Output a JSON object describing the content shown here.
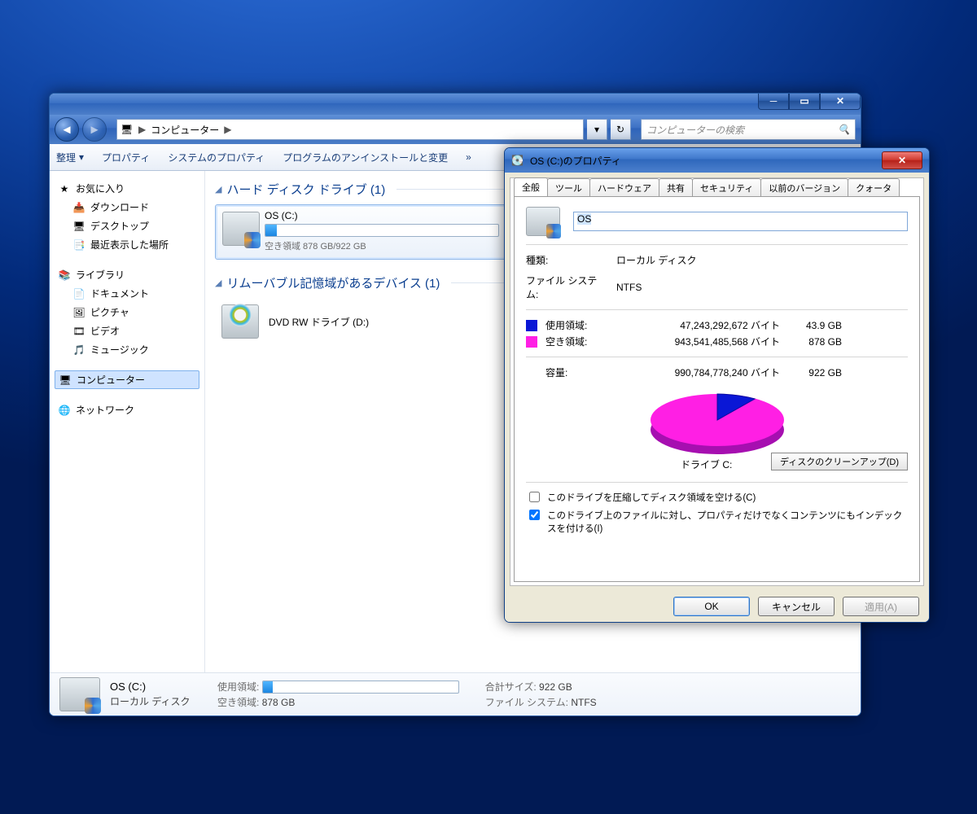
{
  "explorer": {
    "address": {
      "segments": [
        "コンピューター"
      ],
      "search_placeholder": "コンピューターの検索"
    },
    "toolbar": {
      "organize": "整理",
      "properties": "プロパティ",
      "systemProperties": "システムのプロパティ",
      "uninstall": "プログラムのアンインストールと変更",
      "more": "»"
    },
    "nav": {
      "favorites": "お気に入り",
      "downloads": "ダウンロード",
      "desktop": "デスクトップ",
      "recent": "最近表示した場所",
      "libraries": "ライブラリ",
      "documents": "ドキュメント",
      "pictures": "ピクチャ",
      "videos": "ビデオ",
      "music": "ミュージック",
      "computer": "コンピューター",
      "network": "ネットワーク"
    },
    "sections": {
      "hdd": "ハード ディスク ドライブ (1)",
      "removable": "リムーバブル記憶域があるデバイス (1)"
    },
    "drives": {
      "os": {
        "name": "OS (C:)",
        "free_line": "空き領域 878 GB/922 GB"
      },
      "dvd": {
        "name": "DVD RW ドライブ (D:)"
      }
    },
    "status": {
      "name": "OS (C:)",
      "type": "ローカル ディスク",
      "usedLabel": "使用領域:",
      "freeLabel": "空き領域:",
      "freeValue": "878 GB",
      "totalLabel": "合計サイズ:",
      "totalValue": "922 GB",
      "fsLabel": "ファイル システム:",
      "fsValue": "NTFS"
    }
  },
  "dialog": {
    "title": "OS (C:)のプロパティ",
    "tabs": [
      "全般",
      "ツール",
      "ハードウェア",
      "共有",
      "セキュリティ",
      "以前のバージョン",
      "クォータ"
    ],
    "nameField": "OS",
    "typeLabel": "種類:",
    "typeValue": "ローカル ディスク",
    "fsLabel": "ファイル システム:",
    "fsValue": "NTFS",
    "usedLabel": "使用領域:",
    "usedBytes": "47,243,292,672 バイト",
    "usedGb": "43.9 GB",
    "freeLabel": "空き領域:",
    "freeBytes": "943,541,485,568 バイト",
    "freeGb": "878 GB",
    "capacityLabel": "容量:",
    "capacityBytes": "990,784,778,240 バイト",
    "capacityGb": "922 GB",
    "driveLabel": "ドライブ C:",
    "cleanupBtn": "ディスクのクリーンアップ(D)",
    "compress": "このドライブを圧縮してディスク領域を空ける(C)",
    "index": "このドライブ上のファイルに対し、プロパティだけでなくコンテンツにもインデックスを付ける(I)",
    "ok": "OK",
    "cancel": "キャンセル",
    "apply": "適用(A)"
  },
  "chart_data": {
    "type": "pie",
    "title": "ドライブ C:",
    "series": [
      {
        "name": "使用領域",
        "value": 43.9,
        "unit": "GB",
        "bytes": 47243292672,
        "color": "#0a17d6"
      },
      {
        "name": "空き領域",
        "value": 878,
        "unit": "GB",
        "bytes": 943541485568,
        "color": "#ff1fe4"
      }
    ],
    "total": {
      "name": "容量",
      "value": 922,
      "unit": "GB",
      "bytes": 990784778240
    }
  }
}
